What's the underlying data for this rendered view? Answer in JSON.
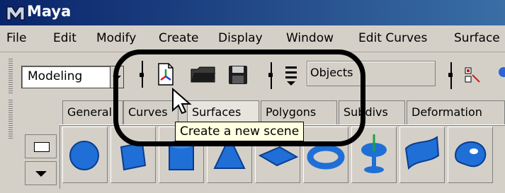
{
  "window": {
    "title": "Maya"
  },
  "menu": [
    "File",
    "Edit",
    "Modify",
    "Create",
    "Display",
    "Window",
    "Edit Curves",
    "Surface"
  ],
  "toolbar": {
    "mode_value": "Modeling",
    "objects_label": "Objects"
  },
  "shelf_tabs": [
    "General",
    "Curves",
    "Surfaces",
    "Polygons",
    "Subdivs",
    "Deformation"
  ],
  "shelf_items": [
    "sphere",
    "cube",
    "cylinder",
    "cone",
    "plane",
    "torus",
    "blue-trophy",
    "blue-twist",
    "blue-bean"
  ],
  "tooltip": {
    "text": "Create a new scene"
  },
  "colors": {
    "titlebar": "#0a246a",
    "callout": "#000000",
    "shelf_blue": "#1f6fd6",
    "tooltip_bg": "#ffffe1"
  }
}
